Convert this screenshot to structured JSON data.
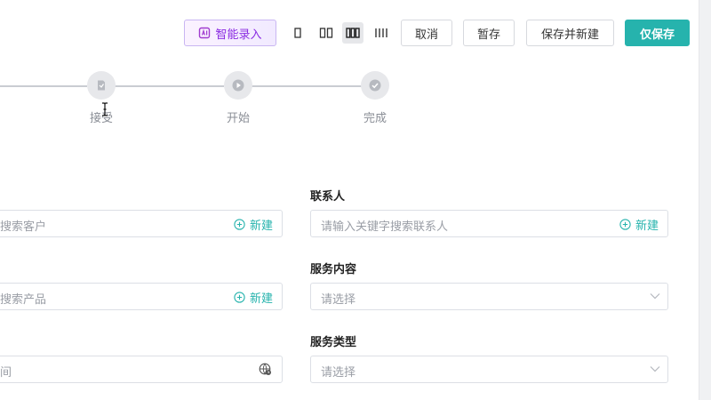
{
  "toolbar": {
    "ai_button": "智能录入",
    "cancel": "取消",
    "draft": "暂存",
    "save_new": "保存并新建",
    "save_only": "仅保存",
    "layout_options": [
      "single-column-icon",
      "two-column-icon",
      "three-column-icon",
      "four-column-icon"
    ],
    "active_layout": "three-column-icon"
  },
  "steps": [
    {
      "label": "接受",
      "icon": "document-icon"
    },
    {
      "label": "开始",
      "icon": "play-icon"
    },
    {
      "label": "完成",
      "icon": "check-icon"
    }
  ],
  "form": {
    "customer": {
      "placeholder": "搜索客户",
      "action": "新建"
    },
    "product": {
      "placeholder": "搜索产品",
      "action": "新建"
    },
    "time": {
      "placeholder": "间"
    },
    "contact": {
      "label": "联系人",
      "placeholder": "请输入关键字搜索联系人",
      "action": "新建"
    },
    "service_content": {
      "label": "服务内容",
      "placeholder": "请选择"
    },
    "service_type": {
      "label": "服务类型",
      "placeholder": "请选择"
    }
  },
  "colors": {
    "accent": "#26b3ad",
    "ai": "#8a2be2",
    "background": "#f0f1f3"
  }
}
